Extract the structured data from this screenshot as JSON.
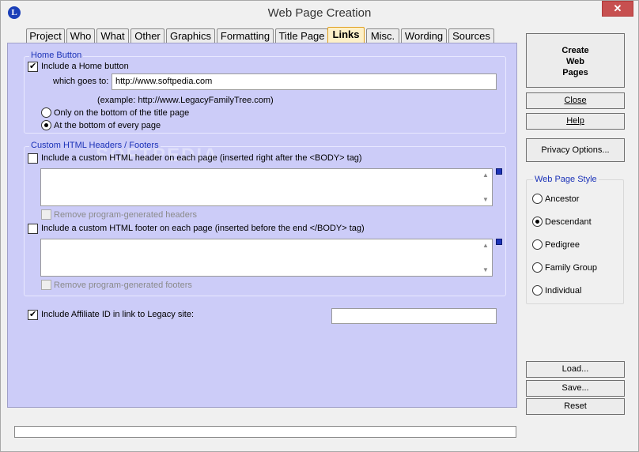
{
  "window": {
    "title": "Web Page Creation",
    "app_icon": "L",
    "close_glyph": "✕"
  },
  "tabs": [
    {
      "label": "Project"
    },
    {
      "label": "Who"
    },
    {
      "label": "What"
    },
    {
      "label": "Other"
    },
    {
      "label": "Graphics"
    },
    {
      "label": "Formatting"
    },
    {
      "label": "Title Page"
    },
    {
      "label": "Links",
      "active": true
    },
    {
      "label": "Misc."
    },
    {
      "label": "Wording"
    },
    {
      "label": "Sources"
    }
  ],
  "home_button": {
    "group_title": "Home Button",
    "include_label": "Include a Home button",
    "include_checked": true,
    "goes_to_label": "which goes to:",
    "url_value": "http://www.softpedia.com",
    "example_text": "(example:  http://www.LegacyFamilyTree.com)",
    "option_title_page": "Only on the bottom of the title page",
    "option_every_page": "At the bottom of every page",
    "selected_option": "every_page"
  },
  "custom_html": {
    "group_title": "Custom HTML Headers / Footers",
    "header_label": "Include a custom HTML header on each page (inserted right after the <BODY> tag)",
    "header_checked": false,
    "remove_headers_label": "Remove program-generated headers",
    "footer_label": "Include a custom HTML footer on each page (inserted before the end </BODY> tag)",
    "footer_checked": false,
    "remove_footers_label": "Remove program-generated footers"
  },
  "affiliate": {
    "label": "Include Affiliate ID in link to Legacy site:",
    "checked": true,
    "value": ""
  },
  "buttons": {
    "create": "Create\nWeb\nPages",
    "close": "Close",
    "help": "Help",
    "privacy": "Privacy Options...",
    "load": "Load...",
    "save": "Save...",
    "reset": "Reset"
  },
  "style_group": {
    "title": "Web Page Style",
    "options": [
      {
        "label": "Ancestor",
        "checked": false
      },
      {
        "label": "Descendant",
        "checked": true
      },
      {
        "label": "Pedigree",
        "checked": false
      },
      {
        "label": "Family Group",
        "checked": false
      },
      {
        "label": "Individual",
        "checked": false
      }
    ]
  },
  "status": {
    "text": ""
  },
  "watermark": "SOFTPEDIA"
}
